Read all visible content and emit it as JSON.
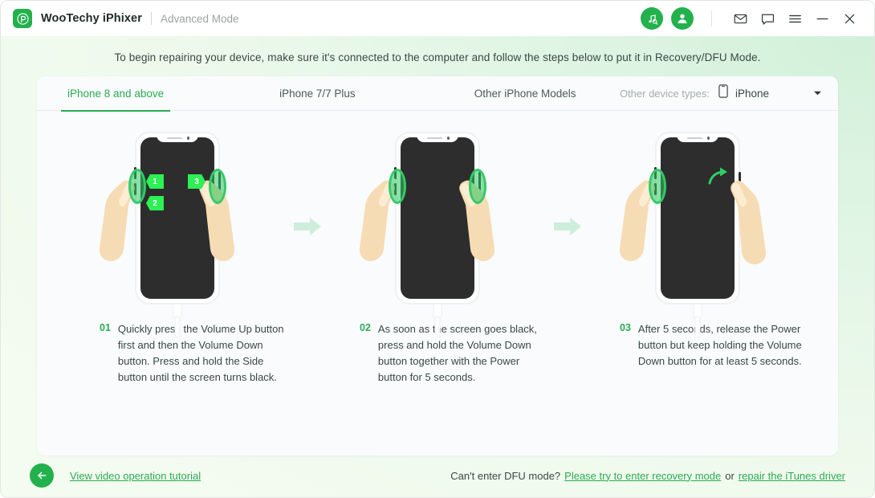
{
  "titlebar": {
    "app_name": "WooTechy iPhixer",
    "mode": "Advanced Mode",
    "logo_icon": "wootechy-p-logo-icon",
    "icons": {
      "music_search": "music-search-icon",
      "account": "account-avatar-icon",
      "mail": "mail-icon",
      "feedback": "chat-bubble-icon",
      "menu": "hamburger-menu-icon",
      "minimize": "minimize-icon",
      "close": "close-icon"
    }
  },
  "notice": "To begin repairing your device, make sure it's connected to the computer and follow the steps below to put it in Recovery/DFU Mode.",
  "tabs": [
    {
      "label": "iPhone 8 and above",
      "active": true
    },
    {
      "label": "iPhone 7/7 Plus",
      "active": false
    },
    {
      "label": "Other iPhone Models",
      "active": false
    }
  ],
  "device_types": {
    "label": "Other device types:",
    "icon": "phone-icon",
    "value": "iPhone",
    "caret": "chevron-down-icon"
  },
  "steps": [
    {
      "number": "01",
      "text": "Quickly press the Volume Up button first and then the Volume Down button. Press and hold the Side button until the screen turns black.",
      "badges": [
        "1",
        "2",
        "3"
      ]
    },
    {
      "number": "02",
      "text": "As soon as the screen goes black, press and hold the Volume Down button together with the Power button for 5 seconds.",
      "badges": []
    },
    {
      "number": "03",
      "text": "After 5 seconds, release the Power button but keep holding the Volume Down button for at least 5 seconds.",
      "badges": []
    }
  ],
  "footer": {
    "back_icon": "back-arrow-icon",
    "video_link": "View video operation tutorial",
    "question": "Can't enter DFU mode?",
    "recovery_link": "Please try to enter recovery mode",
    "or": "or",
    "itunes_link": "repair the iTunes driver"
  },
  "colors": {
    "brand_green": "#22b14c",
    "accent_green": "#2bab52",
    "badge_green": "#2cf054",
    "card_bg": "#f9fbfd",
    "phone_screen": "#2d2d2d",
    "arrow_mint": "#cdeedb"
  }
}
